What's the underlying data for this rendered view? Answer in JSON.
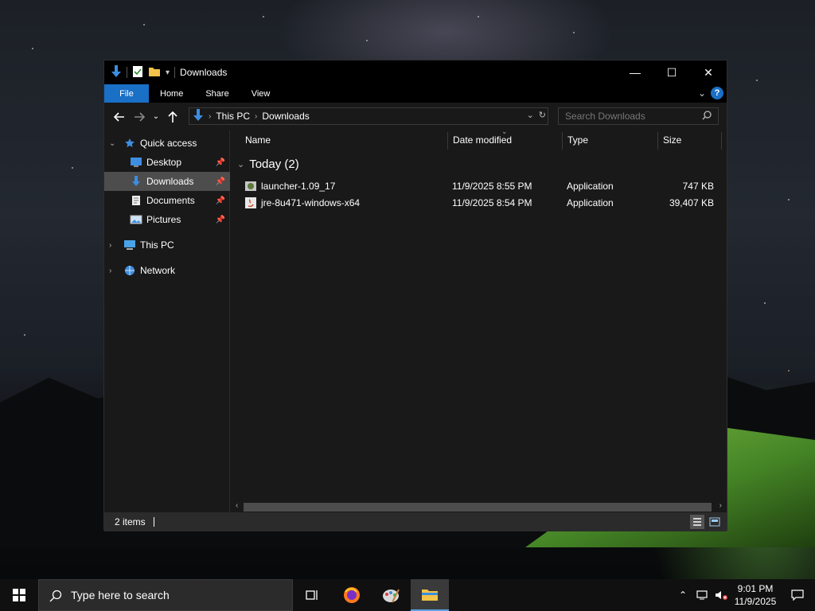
{
  "window": {
    "title": "Downloads",
    "controls": {
      "minimize": "—",
      "maximize": "☐",
      "close": "✕"
    }
  },
  "ribbon": {
    "tabs": [
      "File",
      "Home",
      "Share",
      "View"
    ],
    "help": "?"
  },
  "navigation": {
    "breadcrumbs": [
      "This PC",
      "Downloads"
    ],
    "search_placeholder": "Search Downloads"
  },
  "sidebar": {
    "quick_access": "Quick access",
    "items": [
      {
        "label": "Desktop",
        "icon": "desktop-icon",
        "pinned": true
      },
      {
        "label": "Downloads",
        "icon": "downloads-icon",
        "pinned": true,
        "selected": true
      },
      {
        "label": "Documents",
        "icon": "documents-icon",
        "pinned": true
      },
      {
        "label": "Pictures",
        "icon": "pictures-icon",
        "pinned": true
      }
    ],
    "this_pc": "This PC",
    "network": "Network"
  },
  "columns": [
    "Name",
    "Date modified",
    "Type",
    "Size"
  ],
  "group": {
    "label": "Today (2)"
  },
  "files": [
    {
      "name": "launcher-1.09_17",
      "date": "11/9/2025 8:55 PM",
      "type": "Application",
      "size": "747 KB"
    },
    {
      "name": "jre-8u471-windows-x64",
      "date": "11/9/2025 8:54 PM",
      "type": "Application",
      "size": "39,407 KB"
    }
  ],
  "status": {
    "items": "2 items"
  },
  "taskbar": {
    "search_placeholder": "Type here to search",
    "time": "9:01 PM",
    "date": "11/9/2025"
  },
  "colors": {
    "accent": "#1a6fc6",
    "selected": "#4d4d4d",
    "window_bg": "#191919"
  }
}
